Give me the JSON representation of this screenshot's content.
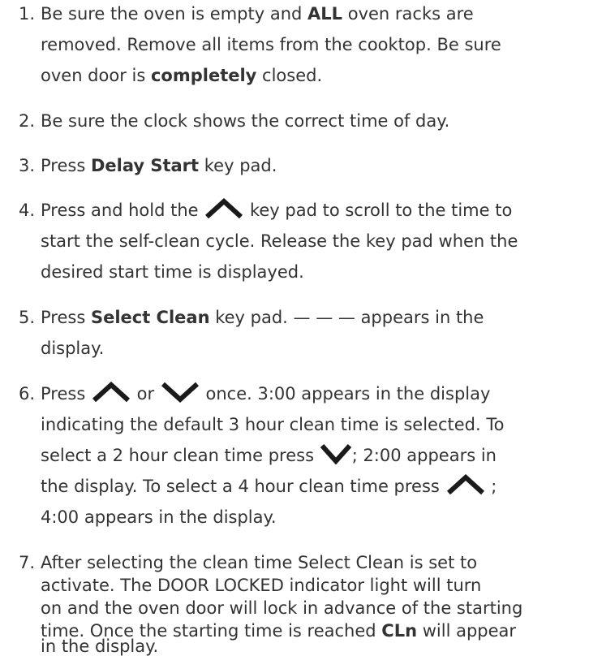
{
  "steps": [
    {
      "number": "1.",
      "lines": [
        [
          "Be sure the oven is empty and ",
          "ALL",
          " oven racks are"
        ],
        [
          "removed. Remove all items from the cooktop. Be sure"
        ],
        [
          "oven door is ",
          "completely",
          " closed."
        ]
      ]
    },
    {
      "number": "2.",
      "lines": [
        [
          "Be sure the clock shows the correct time of day."
        ]
      ]
    },
    {
      "number": "3.",
      "lines": [
        [
          "Press ",
          "Delay Start",
          " key pad."
        ]
      ]
    },
    {
      "number": "4.",
      "lines": [
        [
          "Press and hold the ",
          "key pad to scroll to the time to"
        ],
        [
          "start the self-clean cycle. Release the key pad when the"
        ],
        [
          "desired start time is displayed."
        ]
      ]
    },
    {
      "number": "5.",
      "lines": [
        [
          "Press ",
          "Select Clean",
          " key pad. — — — appears in the"
        ],
        [
          "display."
        ]
      ]
    },
    {
      "number": "6.",
      "lines": [
        [
          "Press ",
          "or",
          "once. 3:00 appears in the display"
        ],
        [
          "indicating the default 3 hour clean time is selected. To"
        ],
        [
          "select a 2 hour clean time press ",
          "; 2:00 appears in"
        ],
        [
          "the display. To select a 4 hour clean time press ",
          ";"
        ],
        [
          "4:00 appears in the display."
        ]
      ]
    },
    {
      "number": "7.",
      "lines": [
        [
          "After selecting the clean time Select Clean is set to"
        ],
        [
          "activate.  The DOOR LOCKED indicator light will turn"
        ],
        [
          "on and the oven door will lock in advance of the starting"
        ],
        [
          "time. Once the starting time is reached ",
          "CLn",
          " will appear"
        ],
        [
          "in the display."
        ]
      ]
    }
  ],
  "icons": {
    "up": "up-arrow-icon",
    "down": "down-arrow-icon"
  },
  "colors": {
    "text": "#333333",
    "icon": "#1a1a1a"
  }
}
